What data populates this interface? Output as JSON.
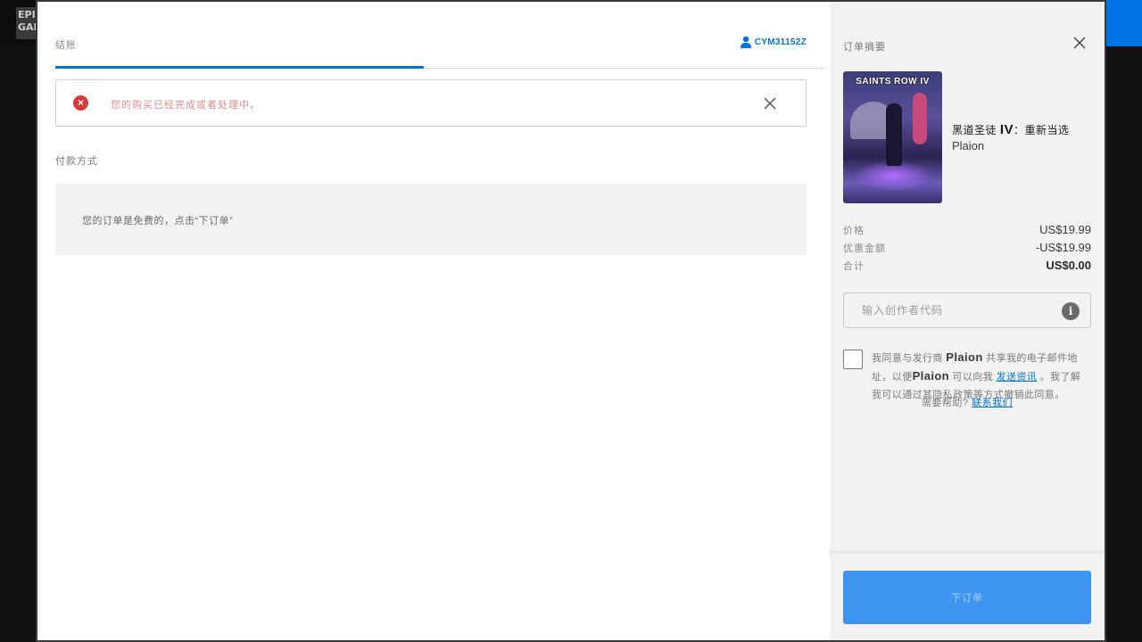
{
  "background": {
    "logo_text": "EPIC GAMES"
  },
  "checkout": {
    "tab_title": "结账",
    "account_name": "CYM31152Z",
    "alert_message": "您的购买已经完成或者处理中。",
    "payment_section_title": "付款方式",
    "payment_notice": "您的订单是免费的，点击“下订单”"
  },
  "summary": {
    "title": "订单摘要",
    "cover_text": "SAINTS ROW IV",
    "game_name_prefix": "黑道圣徒",
    "game_name_numeral": "IV",
    "game_name_suffix": "：重新当选",
    "publisher": "Plaion",
    "prices": {
      "price_label": "价格",
      "price_value": "US$19.99",
      "discount_label": "优惠金额",
      "discount_value": "-US$19.99",
      "total_label": "合计",
      "total_value": "US$0.00"
    },
    "code_placeholder": "输入创作者代码",
    "info_icon_glyph": "i",
    "consent": {
      "part1": "我同意与发行商",
      "publisher_1": "Plaion",
      "part2": "共享我的电子邮件地址，以便",
      "publisher_2": "Plaion",
      "part3": "可以向我",
      "link_text": "发送资讯",
      "part4": "。我了解我可以通过其隐私政策等方式撤销此同意。"
    },
    "help_prefix": "需要帮助?",
    "help_link": "联系我们",
    "order_button": "下订单"
  },
  "colors": {
    "accent": "#0074e4",
    "button": "#3e95ef",
    "error": "#d93a3a"
  },
  "icons": {
    "user": "user-icon",
    "close": "close-icon",
    "error": "error-circle-icon",
    "info": "info-icon"
  }
}
